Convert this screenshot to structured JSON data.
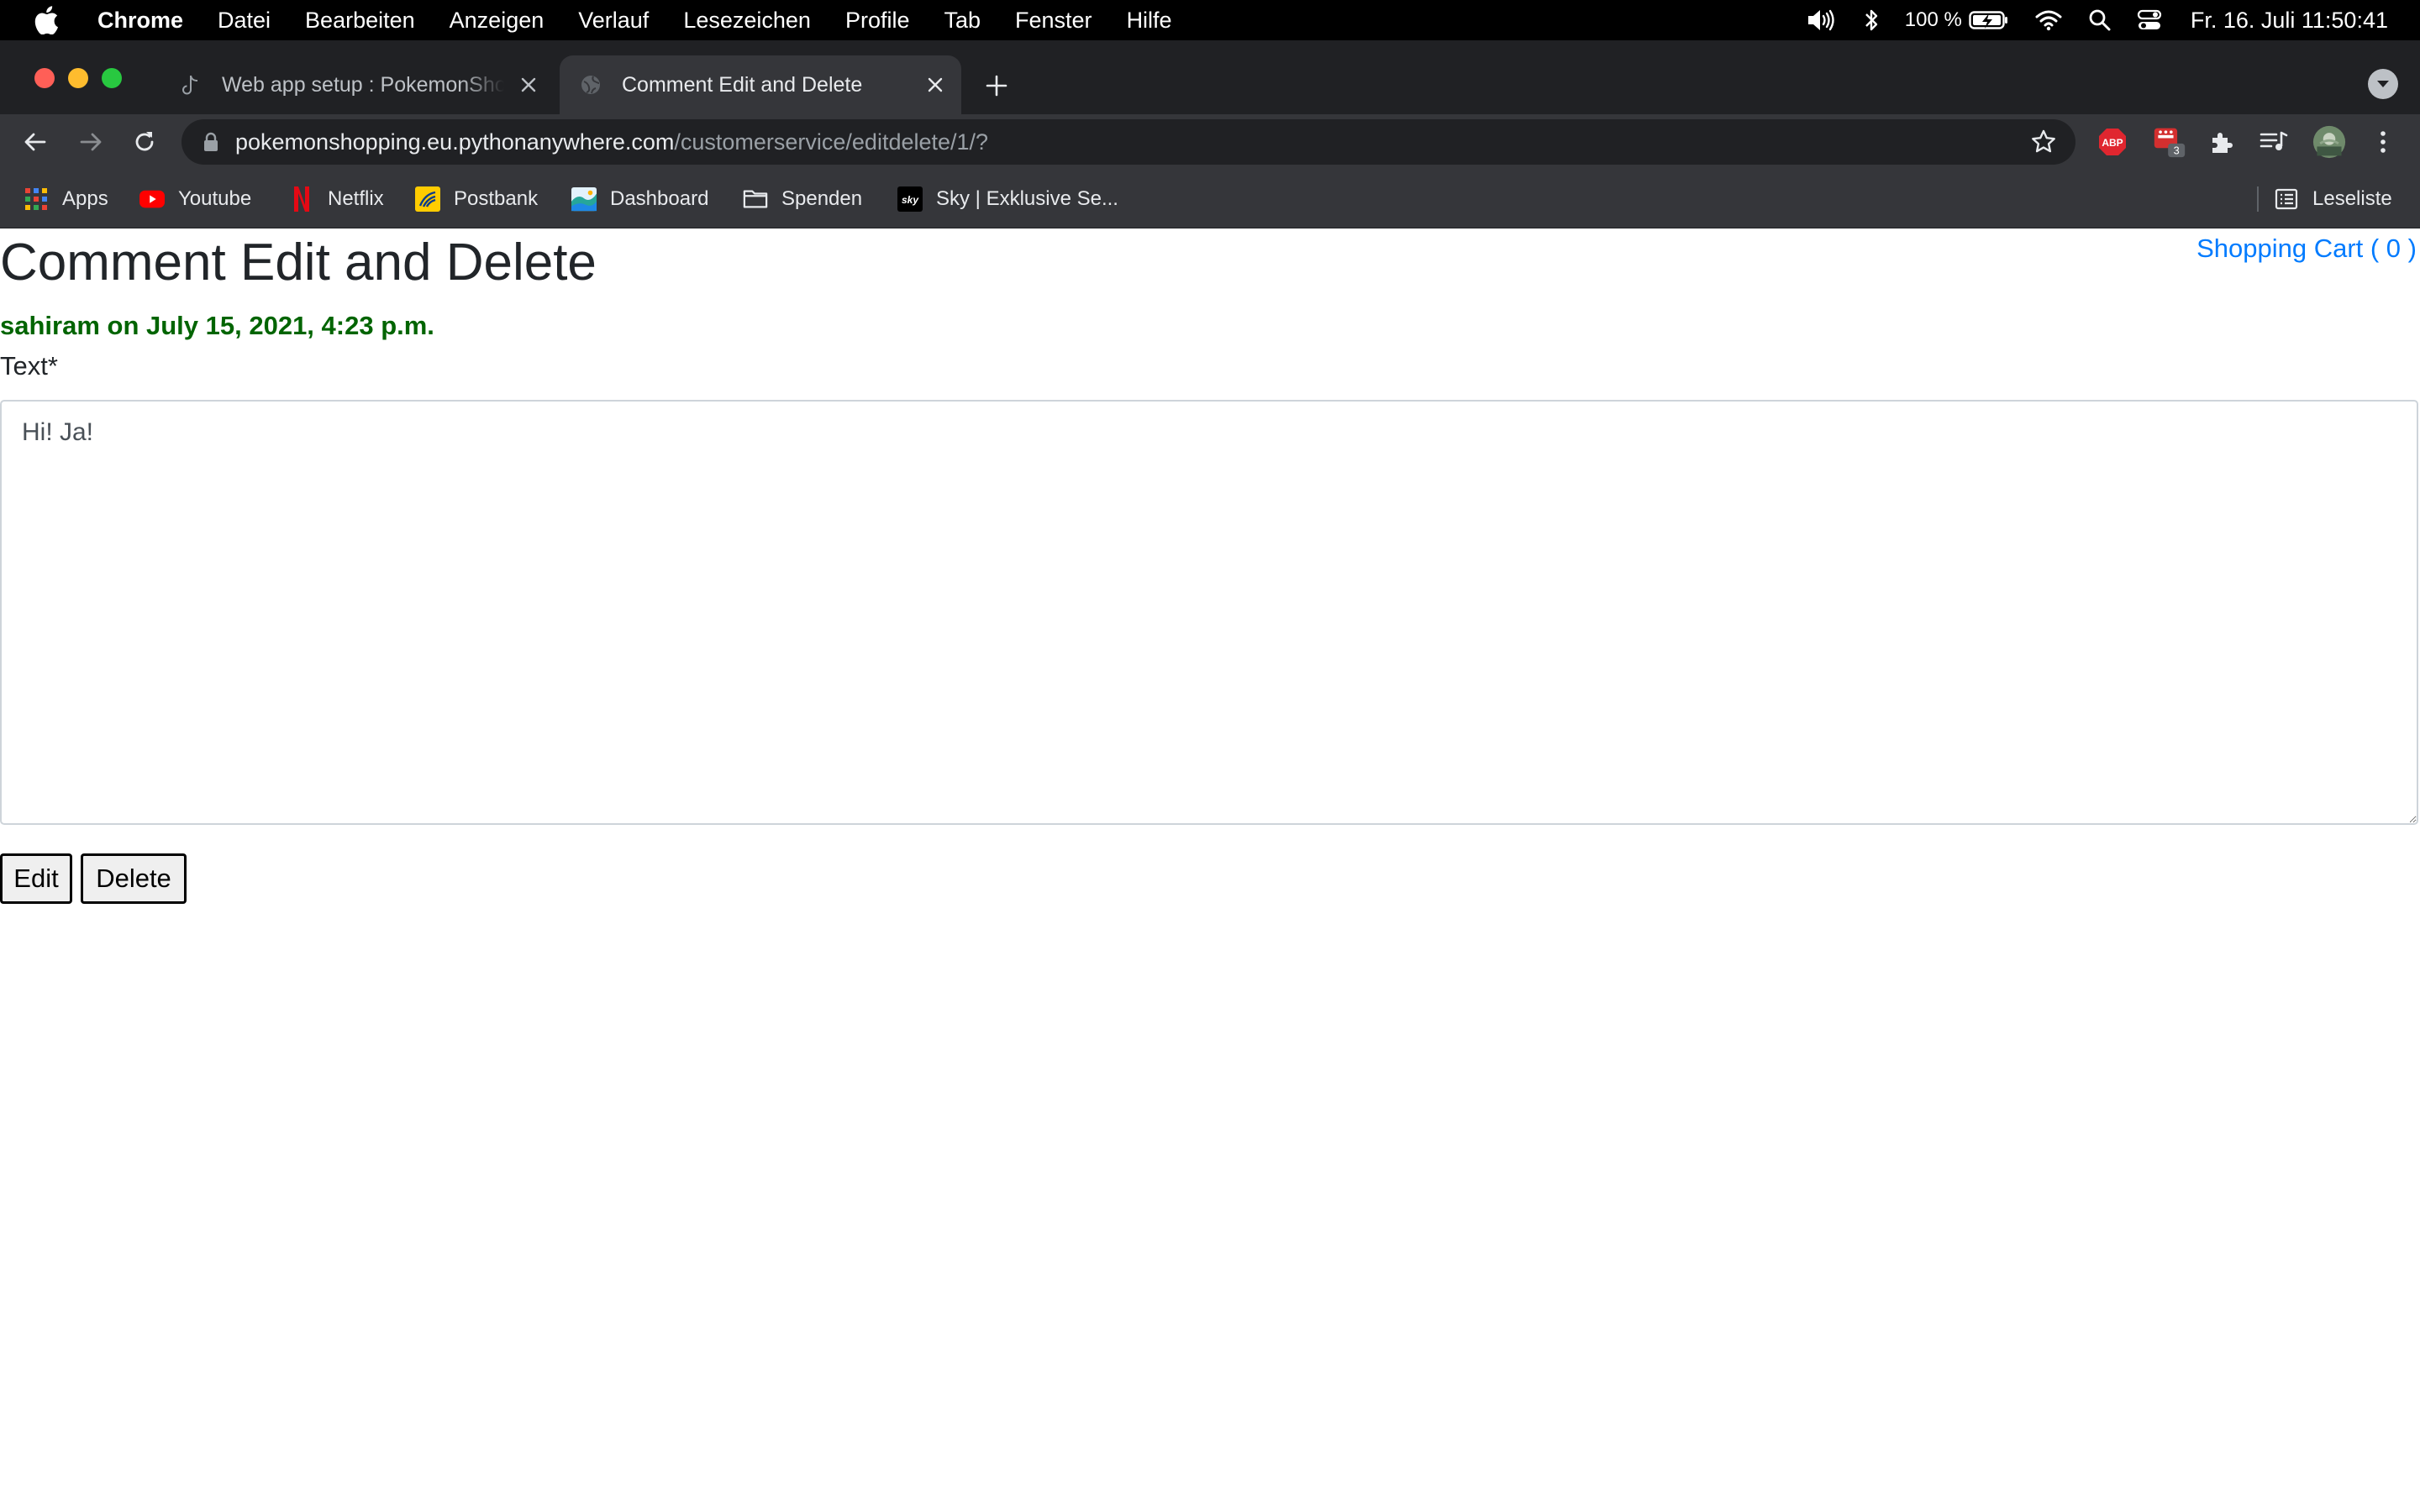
{
  "menubar": {
    "app_name": "Chrome",
    "items": [
      "Datei",
      "Bearbeiten",
      "Anzeigen",
      "Verlauf",
      "Lesezeichen",
      "Profile",
      "Tab",
      "Fenster",
      "Hilfe"
    ],
    "battery": "100 %",
    "clock": "Fr. 16. Juli  11:50:41"
  },
  "tabs": [
    {
      "title": "Web app setup : PokemonShopping",
      "icon": "tiktok-icon",
      "active": false
    },
    {
      "title": "Comment Edit and Delete",
      "icon": "globe-icon",
      "active": true
    }
  ],
  "address_bar": {
    "host": "pokemonshopping.eu.pythonanywhere.com",
    "path": "/customerservice/editdelete/1/?"
  },
  "extensions": {
    "adblock_label": "ABP",
    "badge_count": "3"
  },
  "bookmarks": {
    "items": [
      {
        "label": "Apps",
        "icon": "apps-grid-icon"
      },
      {
        "label": "Youtube",
        "icon": "youtube-icon"
      },
      {
        "label": "Netflix",
        "icon": "netflix-icon"
      },
      {
        "label": "Postbank",
        "icon": "postbank-icon"
      },
      {
        "label": "Dashboard",
        "icon": "dashboard-icon"
      },
      {
        "label": "Spenden",
        "icon": "folder-icon"
      },
      {
        "label": "Sky | Exklusive Se...",
        "icon": "sky-icon"
      }
    ],
    "reading_list": "Leseliste"
  },
  "page": {
    "title": "Comment Edit and Delete",
    "cart_link": "Shopping Cart ( 0 )",
    "author_line": "sahiram on July 15, 2021, 4:23 p.m.",
    "field_label": "Text*",
    "comment_value": "Hi! Ja!",
    "edit_button": "Edit",
    "delete_button": "Delete"
  },
  "colors": {
    "author_green": "#006400",
    "link_blue": "#007bff"
  }
}
